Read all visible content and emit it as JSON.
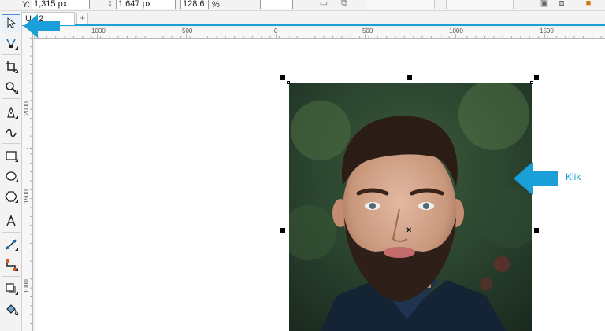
{
  "property_bar": {
    "y_label": "Y:",
    "y_value": "1,315 px",
    "height_value": "1,647 px",
    "scale_value": "128.6",
    "scale_unit": "%"
  },
  "document": {
    "tab_label": "U...2",
    "add_tab": "+"
  },
  "ruler": {
    "h_labels": [
      "1000",
      "500",
      "0",
      "500",
      "1000",
      "1500"
    ],
    "v_labels": [
      "2000",
      "1500",
      "1000"
    ]
  },
  "annotation": {
    "callout_text": "Klik",
    "accent_color": "#1a9fd8"
  },
  "toolbox": {
    "tools": [
      "pick-tool",
      "shape-tool",
      "crop-tool",
      "zoom-tool",
      "freehand-tool",
      "artistic-media-tool",
      "rectangle-tool",
      "ellipse-tool",
      "polygon-tool",
      "text-tool",
      "parallel-dimension-tool",
      "connector-tool",
      "drop-shadow-tool",
      "fill-tool"
    ]
  }
}
